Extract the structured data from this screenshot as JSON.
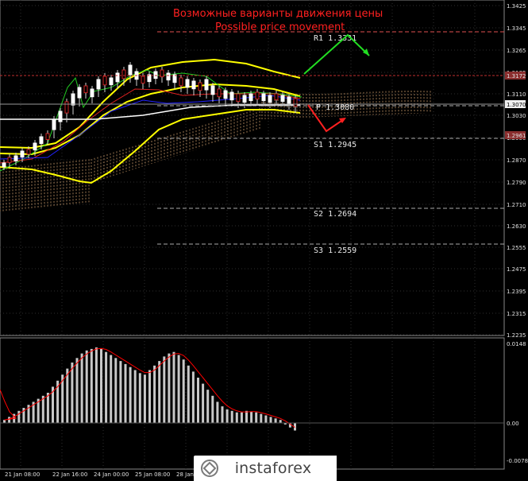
{
  "title": {
    "line1": "Возможные варианты движения цены",
    "line2": "Possible price movement"
  },
  "price_axis": {
    "ticks": [
      "1.3425",
      "1.3345",
      "1.3265",
      "1.3185",
      "1.3110",
      "1.3030",
      "1.2950",
      "1.2870",
      "1.2790",
      "1.2710",
      "1.2630",
      "1.2555",
      "1.2475",
      "1.2395",
      "1.2315",
      "1.2235"
    ],
    "current_price": "1.3070",
    "r1_tag": "1.3172",
    "s1_tag": "1.2961"
  },
  "pivot_levels": [
    {
      "label": "R1",
      "value": "1.3331"
    },
    {
      "label": "P",
      "value": "1.3080"
    },
    {
      "label": "S1",
      "value": "1.2945"
    },
    {
      "label": "S2",
      "value": "1.2694"
    },
    {
      "label": "S3",
      "value": "1.2559"
    }
  ],
  "oscillator_axis": {
    "top": "0.0148",
    "zero": "0.00",
    "bottom": "-0.00788"
  },
  "time_axis": [
    "21 Jan 08:00",
    "22 Jan 16:00",
    "24 Jan 00:00",
    "25 Jan 08:00",
    "28 Jan"
  ],
  "logo": {
    "text": "instaforex"
  },
  "colors": {
    "background": "#000000",
    "bollinger": "#ffff00",
    "ichimoku_cloud": "#d2a06e",
    "title": "#ff2020",
    "arrow_up": "#22dd22",
    "arrow_down": "#ff2020",
    "signal_line": "#ff0000",
    "histogram": "#c8c8c8"
  }
}
